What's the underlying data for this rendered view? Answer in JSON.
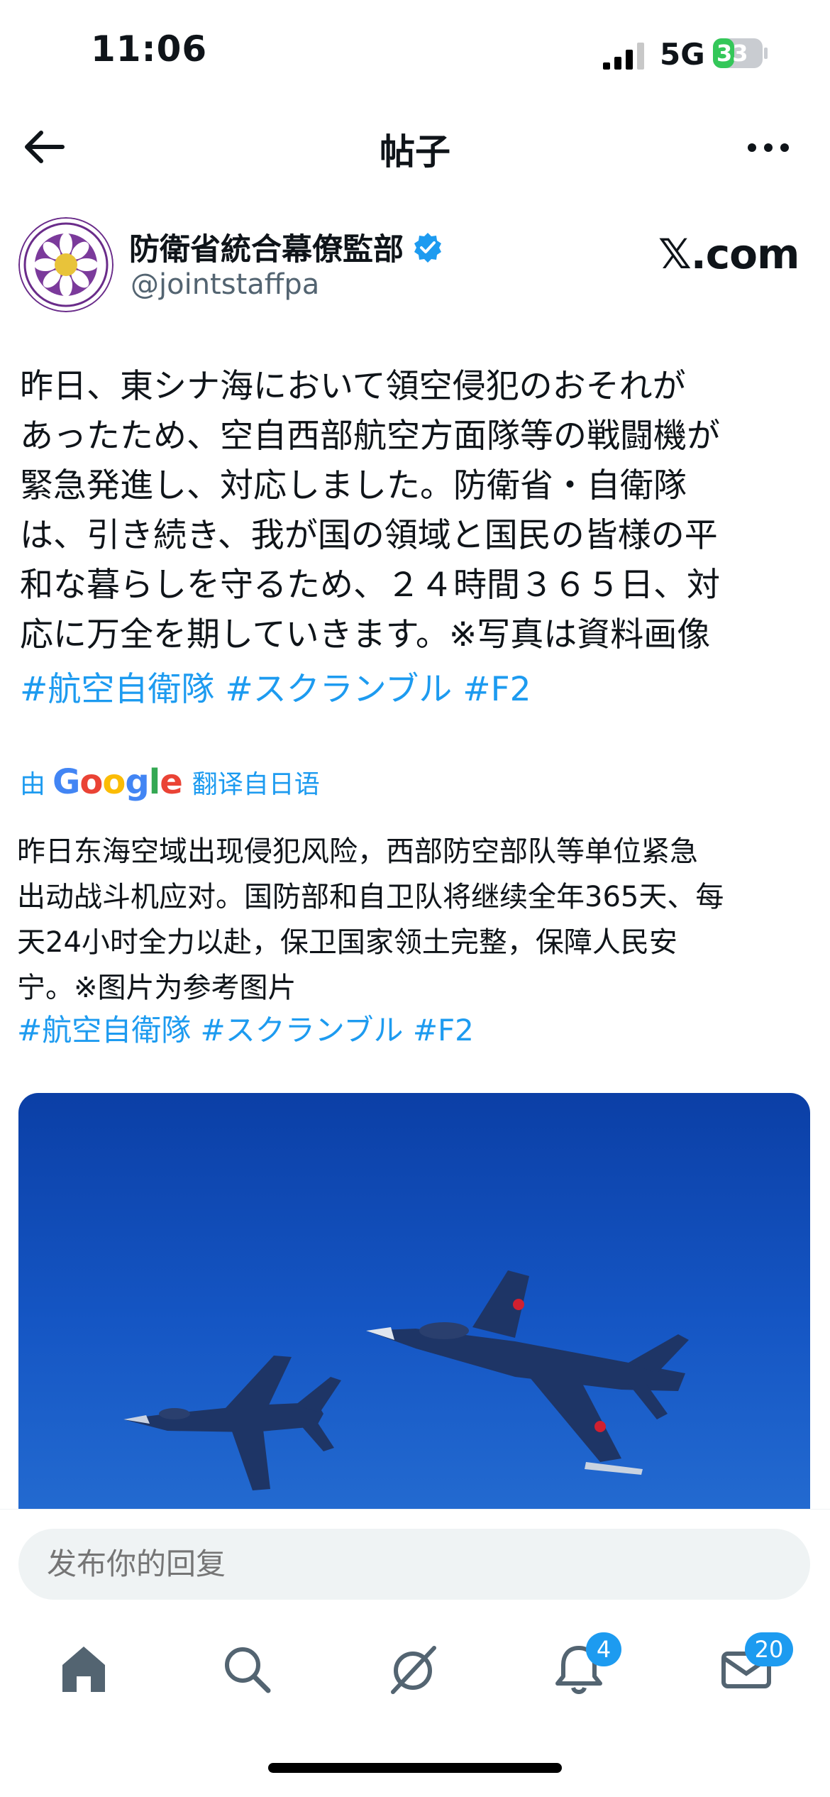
{
  "status_bar": {
    "time": "11:06",
    "network": "5G",
    "battery": "33"
  },
  "header": {
    "title": "帖子",
    "back_icon": "arrow-left-icon",
    "more_icon": "more-horizontal-icon"
  },
  "author": {
    "name": "防衛省統合幕僚監部",
    "handle": "@jointstaffpa",
    "verified": true,
    "source": "𝕏.com",
    "avatar_icon": "ministry-of-defense-emblem"
  },
  "post": {
    "text": "昨日、東シナ海において領空侵犯のおそれが\nあったため、空自西部航空方面隊等の戦闘機が\n緊急発進し、対応しました。防衛省・自衛隊\nは、引き続き、我が国の領域と国民の皆様の平\n和な暮らしを守るため、２４時間３６５日、対\n応に万全を期していきます。※写真は資料画像",
    "hashtags": "#航空自衛隊 #スクランブル #F2"
  },
  "translation": {
    "prefix": "由",
    "provider": "Google",
    "suffix": "翻译自日语",
    "text": "昨日东海空域出现侵犯风险，西部防空部队等单位紧急\n出动战斗机应对。国防部和自卫队将继续全年365天、每\n天24小时全力以赴，保卫国家领土完整，保障人民安\n宁。※图片为参考图片",
    "hashtags": "#航空自衛隊 #スクランブル #F2"
  },
  "image": {
    "subject": "two-jet-fighters-in-blue-sky"
  },
  "reply": {
    "placeholder": "发布你的回复"
  },
  "nav": {
    "items": [
      {
        "icon": "home-icon"
      },
      {
        "icon": "search-icon"
      },
      {
        "icon": "grok-icon"
      },
      {
        "icon": "bell-icon",
        "badge": "4"
      },
      {
        "icon": "mail-icon",
        "badge": "20"
      }
    ]
  },
  "colors": {
    "accent": "#1d9bf0",
    "text": "#0f1419",
    "muted": "#536471"
  }
}
